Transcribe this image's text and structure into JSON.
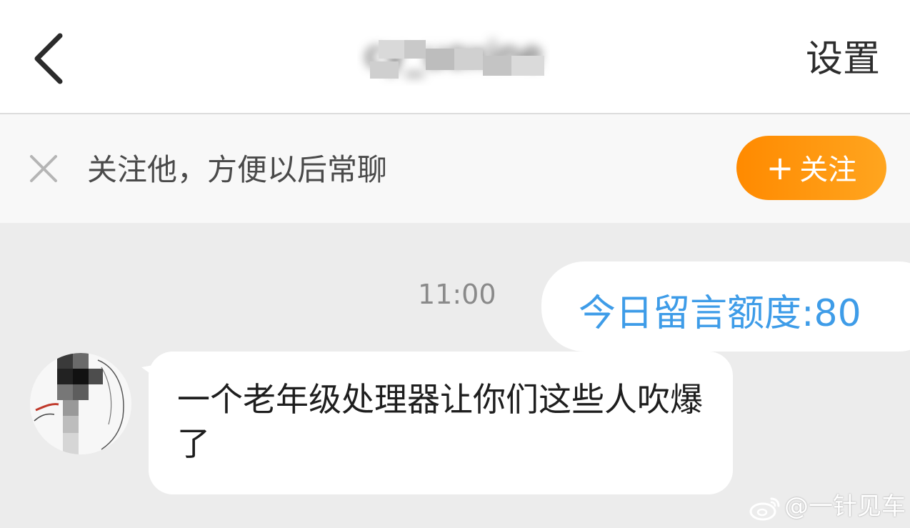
{
  "header": {
    "title": "cy_uoxine",
    "settings_label": "设置"
  },
  "follow_prompt": {
    "text": "关注他，方便以后常聊",
    "button_plus": "+",
    "button_label": "关注"
  },
  "messages": [
    {
      "side": "right",
      "time": "11:00",
      "text": "今日留言额度:80"
    },
    {
      "side": "left",
      "text": "一个老年级处理器让你们这些人吹爆了"
    }
  ],
  "watermark": {
    "text": "@一针见车"
  },
  "colors": {
    "accent_orange": "#ff8a00",
    "link_blue": "#3e9ce8",
    "background": "#ececec"
  },
  "icons": [
    "back-arrow-icon",
    "close-icon",
    "weibo-logo-icon"
  ]
}
